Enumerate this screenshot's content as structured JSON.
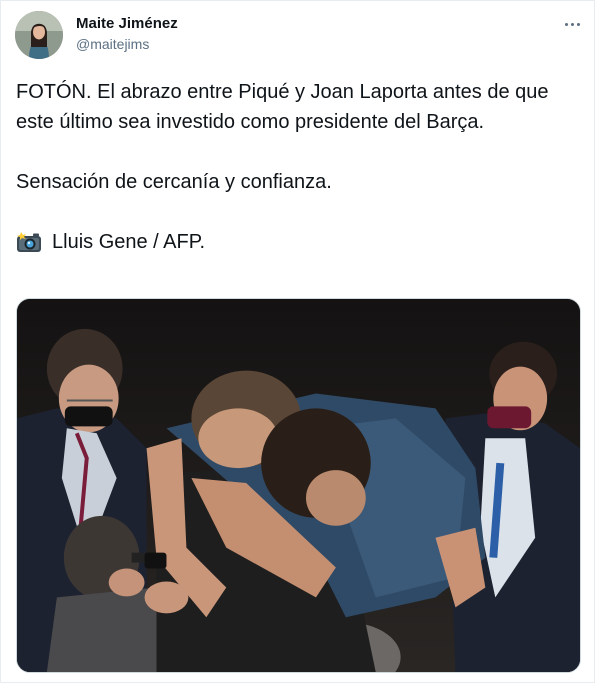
{
  "author": {
    "name": "Maite Jiménez",
    "handle": "@maitejims"
  },
  "tweet": {
    "paragraphs": [
      "FOTÓN. El abrazo entre Piqué y Joan Laporta antes de que este último sea investido como presidente del Barça.",
      "Sensación de cercanía y confianza."
    ],
    "credit_text": "Lluis Gene / AFP.",
    "credit_icon": "camera-with-flash-icon"
  },
  "icons": {
    "more": "more-options-icon"
  }
}
